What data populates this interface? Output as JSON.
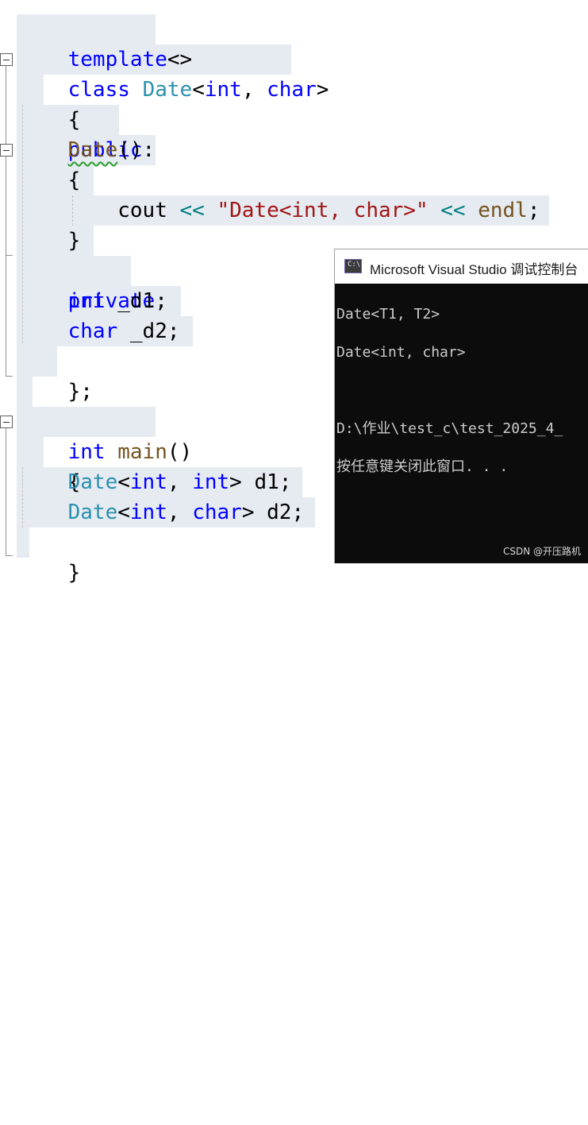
{
  "editor": {
    "lines": {
      "l1": {
        "template": "template",
        "args": "<>"
      },
      "l2": {
        "class": "class",
        "name": "Date",
        "open": "<",
        "t1": "int",
        "comma": ",",
        "t2": "char",
        "close": ">"
      },
      "l3": {
        "brace": "{"
      },
      "l4": {
        "public": "public",
        "colon": ":"
      },
      "l5": {
        "ctor": "Date",
        "parens": "()"
      },
      "l6": {
        "brace": "{"
      },
      "l7": {
        "cout": "cout",
        "op1": "<<",
        "str": "\"Date<int, char>\"",
        "op2": "<<",
        "endl": "endl",
        "semi": ";"
      },
      "l8": {
        "brace": "}"
      },
      "l9": {
        "private": "private",
        "colon": ":"
      },
      "l10": {
        "type": "int",
        "name": "_d1",
        "semi": ";"
      },
      "l11": {
        "type": "char",
        "name": "_d2",
        "semi": ";"
      },
      "l12": {
        "close": "};"
      },
      "l14": {
        "type": "int",
        "name": "main",
        "parens": "()"
      },
      "l15": {
        "brace": "{"
      },
      "l16": {
        "type": "Date",
        "open": "<",
        "t1": "int",
        "comma": ",",
        "t2": "int",
        "close": ">",
        "var": "d1",
        "semi": ";"
      },
      "l17": {
        "type": "Date",
        "open": "<",
        "t1": "int",
        "comma": ",",
        "t2": "char",
        "close": ">",
        "var": "d2",
        "semi": ";"
      },
      "l18": {
        "brace": "}"
      }
    }
  },
  "console": {
    "title": "Microsoft Visual Studio 调试控制台",
    "icon_label": "C:\\",
    "output": [
      "Date<T1, T2>",
      "Date<int, char>",
      "",
      "D:\\作业\\test_c\\test_2025_4_",
      "按任意键关闭此窗口. . ."
    ]
  },
  "watermark": "CSDN @开压路机",
  "colors": {
    "keyword": "#0000ff",
    "type": "#2b91af",
    "function": "#74531f",
    "string": "#a31515",
    "operator": "#008080",
    "line_highlight": "#e5ebf1",
    "console_bg": "#0c0c0c",
    "console_text": "#cccccc"
  }
}
